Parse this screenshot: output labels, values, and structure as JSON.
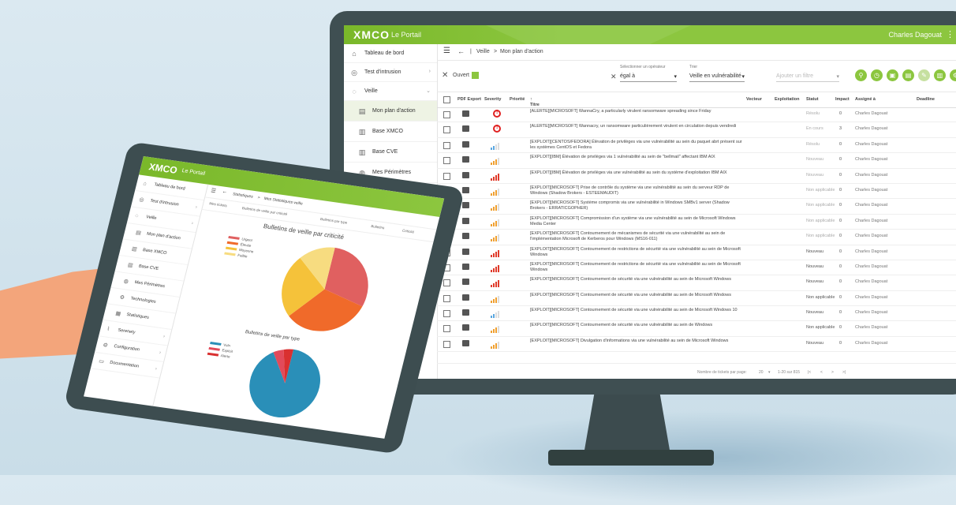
{
  "brand": {
    "logo": "XMCO",
    "portal": "Le Portail"
  },
  "colors": {
    "green": "#8cc63f",
    "crit": "#e02020",
    "high": "#e03a2a",
    "medium": "#f0a030",
    "low": "#5aa7e0"
  },
  "monitor": {
    "user": "Charles Dagouat",
    "sidebar": [
      {
        "label": "Tableau de bord",
        "icon": "home-icon"
      },
      {
        "label": "Test d'intrusion",
        "icon": "target-icon"
      },
      {
        "label": "Veille",
        "icon": "radar-icon"
      },
      {
        "label": "Mon plan d'action",
        "icon": "list-icon"
      },
      {
        "label": "Base XMCO",
        "icon": "database-icon"
      },
      {
        "label": "Base CVE",
        "icon": "database-icon"
      },
      {
        "label": "Mes Périmètres",
        "icon": "globe-icon"
      },
      {
        "label": "Technologies",
        "icon": "gear-icon"
      },
      {
        "label": "Statistiques",
        "icon": "chart-icon"
      },
      {
        "label": "Serenety",
        "icon": "signal-icon"
      }
    ],
    "breadcrumb": {
      "part1": "Veille",
      "sep": ">",
      "part2": "Mon plan d'action"
    },
    "filters": {
      "chip": "Ouvert",
      "op_label": "Sélectionner un opérateur",
      "op_value": "égal à",
      "sort_label": "Trier",
      "sort_value": "Veille en vulnérabilité",
      "add_placeholder": "Ajouter un filtre"
    },
    "columns": [
      "PDF Export",
      "Severity",
      "Priorité",
      "Titre",
      "Vecteur",
      "Exploitation",
      "Statut",
      "Impact",
      "Assigné à",
      "Deadline"
    ],
    "rows": [
      {
        "sev": "crit",
        "title": "[ALERTE][MICROSOFT] WannaCry, a particularly virulent ransomware spreading since Friday",
        "status": "Résolu",
        "impact": "0",
        "assignee": "Charles Dagouat"
      },
      {
        "sev": "crit",
        "title": "[ALERTE][MICROSOFT] Wannacry, un ransomware particulièrement virulent en circulation depuis vendredi",
        "status": "En cours",
        "impact": "3",
        "assignee": "Charles Dagouat"
      },
      {
        "sev": "low",
        "title": "[EXPLOIT][CENTOS/FEDORA] Élévation de privilèges via une vulnérabilité au sein du paquet abrt présent sur les systèmes CentOS et Fedora",
        "status": "Résolu",
        "impact": "0",
        "assignee": "Charles Dagouat"
      },
      {
        "sev": "medium",
        "title": "[EXPLOIT][IBM] Élévation de privilèges via 1 vulnérabilité au sein de \"bellmail\" affectant IBM AIX",
        "status": "Nouveau",
        "impact": "0",
        "assignee": "Charles Dagouat"
      },
      {
        "sev": "high",
        "title": "[EXPLOIT][IBM] Élévation de privilèges via une vulnérabilité au sein du système d'exploitation IBM AIX",
        "status": "Nouveau",
        "impact": "0",
        "assignee": "Charles Dagouat"
      },
      {
        "sev": "medium",
        "title": "[EXPLOIT][MICROSOFT] Prise de contrôle du système via une vulnérabilité au sein du serveur RDP de Windows (Shadow Brokers - ESTEEMAUDIT)",
        "status": "Non applicable",
        "impact": "0",
        "assignee": "Charles Dagouat"
      },
      {
        "sev": "medium",
        "title": "[EXPLOIT][MICROSOFT] Système compromis via une vulnérabilité in Windows SMBv1 server (Shadow Brokers - ERRATICGOPHER)",
        "status": "Non applicable",
        "impact": "0",
        "assignee": "Charles Dagouat"
      },
      {
        "sev": "medium",
        "title": "[EXPLOIT][MICROSOFT] Compromission d'un système via une vulnérabilité au sein de Microsoft Windows Media Center",
        "status": "Non applicable",
        "impact": "0",
        "assignee": "Charles Dagouat"
      },
      {
        "sev": "medium",
        "title": "[EXPLOIT][MICROSOFT] Contournement de mécanismes de sécurité via une vulnérabilité au sein de l'implémentation Microsoft de Kerberos pour Windows (MS16-011)",
        "status": "Non applicable",
        "impact": "0",
        "assignee": "Charles Dagouat"
      },
      {
        "sev": "high",
        "title": "[EXPLOIT][MICROSOFT] Contournement de restrictions de sécurité via une vulnérabilité au sein de Microsoft Windows",
        "status": "Nouveau",
        "impact": "0",
        "assignee": "Charles Dagouat"
      },
      {
        "sev": "high",
        "title": "[EXPLOIT][MICROSOFT] Contournement de restrictions de sécurité via une vulnérabilité au sein de Microsoft Windows",
        "status": "Nouveau",
        "impact": "0",
        "assignee": "Charles Dagouat"
      },
      {
        "sev": "high",
        "title": "[EXPLOIT][MICROSOFT] Contournement de sécurité via une vulnérabilité au sein de Microsoft Windows",
        "status": "Nouveau",
        "impact": "0",
        "assignee": "Charles Dagouat"
      },
      {
        "sev": "medium",
        "title": "[EXPLOIT][MICROSOFT] Contournement de sécurité via une vulnérabilité au sein de Microsoft Windows",
        "status": "Non applicable",
        "impact": "0",
        "assignee": "Charles Dagouat"
      },
      {
        "sev": "low",
        "title": "[EXPLOIT][MICROSOFT] Contournement de sécurité via une vulnérabilité au sein de Microsoft Windows 10",
        "status": "Nouveau",
        "impact": "0",
        "assignee": "Charles Dagouat"
      },
      {
        "sev": "medium",
        "title": "[EXPLOIT][MICROSOFT] Contournement de sécurité via une vulnérabilité au sein de Windows",
        "status": "Non applicable",
        "impact": "0",
        "assignee": "Charles Dagouat"
      },
      {
        "sev": "medium",
        "title": "[EXPLOIT][MICROSOFT] Divulgation d'informations via une vulnérabilité au sein de Microsoft Windows",
        "status": "Nouveau",
        "impact": "0",
        "assignee": "Charles Dagouat"
      }
    ],
    "pager": {
      "per_page_label": "Nombre de tickets par page:",
      "per_page": "20",
      "range": "1-20 sur 815"
    }
  },
  "tablet": {
    "sidebar": [
      {
        "label": "Tableau de bord",
        "icon": "home-icon"
      },
      {
        "label": "Test d'intrusion",
        "icon": "target-icon"
      },
      {
        "label": "Veille",
        "icon": "radar-icon"
      },
      {
        "label": "Mon plan d'action",
        "icon": "list-icon"
      },
      {
        "label": "Base XMCO",
        "icon": "database-icon"
      },
      {
        "label": "Base CVE",
        "icon": "database-icon"
      },
      {
        "label": "Mes Périmètres",
        "icon": "globe-icon"
      },
      {
        "label": "Technologies",
        "icon": "gear-icon"
      },
      {
        "label": "Statistiques",
        "icon": "chart-icon"
      },
      {
        "label": "Serenety",
        "icon": "signal-icon"
      },
      {
        "label": "Configuration",
        "icon": "gear-icon"
      },
      {
        "label": "Documentation",
        "icon": "book-icon"
      }
    ],
    "breadcrumb": {
      "part1": "Statistiques",
      "sep": ">",
      "part2": "Mes Statistiques veille"
    },
    "tabs": [
      "Mes tickets",
      "Bulletins de veille par criticité",
      "Bulletins par type",
      "Bulletins",
      "Criticité"
    ],
    "chart1_title": "Bulletins de veille par criticité",
    "chart1_legend": [
      "Urgent",
      "Élevée",
      "Moyenne",
      "Faible"
    ],
    "chart2_title": "Bulletins de veille par type",
    "chart2_legend": [
      "Vuln",
      "Exploit",
      "Alerte"
    ]
  }
}
